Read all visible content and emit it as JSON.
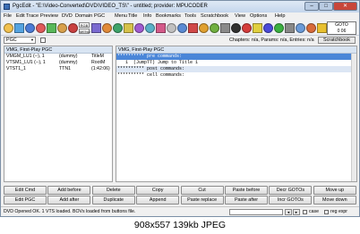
{
  "window": {
    "title": "PgcEdit - \"E:\\Video-Converted\\DVD\\VIDEO_TS\\\" - untitled; provider: MPUCODER"
  },
  "menu": [
    "File",
    "Edit",
    "Trace",
    "Preview",
    "DVD",
    "Domain",
    "PGC",
    "Menu",
    "Title",
    "Info",
    "Bookmarks",
    "Tools",
    "Scratchbook",
    "View",
    "Options",
    "Help"
  ],
  "toolbar": {
    "icons": [
      "open-icon",
      "refresh-icon",
      "save-icon",
      "undo-icon",
      "redo-icon",
      "copy-icon",
      "record-icon",
      "cut-icon",
      "paste-icon",
      "play-icon",
      "chapter-icon",
      "trace-icon",
      "magnify-icon",
      "menu-icon",
      "title-icon",
      "vmg-icon",
      "stop-icon",
      "prev-icon",
      "next-icon",
      "film-icon",
      "clapper-icon",
      "flag-icon",
      "hint-icon",
      "blue-icon",
      "green-icon",
      "grid-icon",
      "eye-icon",
      "target-icon",
      "vts-icon"
    ],
    "indicator_labels": [
      "RGB",
      "MENU"
    ],
    "goto": {
      "label": "GOTO",
      "value": "0 06"
    }
  },
  "optbar": {
    "pgc_select": "PGC",
    "chapters": "Chapters: n/a,  Params: n/a,  Entries: n/a",
    "scratchbook": "Scratchbook"
  },
  "left": {
    "header": "VMG, First-Play PGC",
    "rows": [
      {
        "name": "VMGM_LU1 (--), 1",
        "info": "(dummy)",
        "extra": "TitleM"
      },
      {
        "name": "VTSM1_LU1 (--), 1",
        "info": "(dummy)",
        "extra": "RootM"
      },
      {
        "name": "VTST1_1",
        "info": "TTN1",
        "extra": "(1:42:06)"
      }
    ]
  },
  "right": {
    "header": "VMG, First-Play PGC",
    "lines": [
      "********** pre commands:",
      "   1  (JumpTT) Jump to Title 1",
      "********** post commands:",
      "********** cell commands:"
    ]
  },
  "buttons": {
    "row1": [
      "Edit Cmd",
      "Add before",
      "Delete",
      "Copy",
      "Cut",
      "Paste before",
      "Decr GOTOs",
      "Move up"
    ],
    "row2": [
      "Edit PGC",
      "Add after",
      "Duplicate",
      "Append",
      "Paste replace",
      "Paste after",
      "Incr GOTOs",
      "Move down"
    ]
  },
  "status": {
    "text": "DVD Opened OK. 1 VTS loaded.  BOVs loaded from buttons file.",
    "case_label": "case",
    "regexp_label": "reg expr"
  },
  "caption": "908x557  139kb  JPEG"
}
